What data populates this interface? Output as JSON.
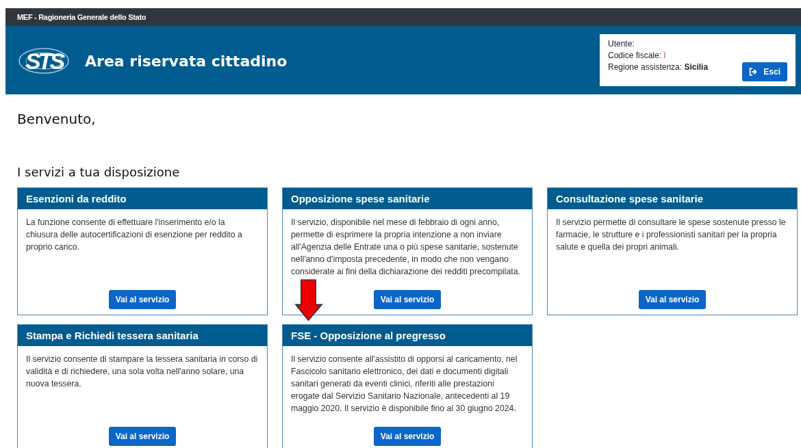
{
  "top_bar": {
    "title": "MEF - Ragioneria Generale dello Stato"
  },
  "header": {
    "logo_text": "STS",
    "title": "Area riservata cittadino"
  },
  "user_panel": {
    "user_label": "Utente:",
    "fiscal_code_label": "Codice fiscale:",
    "fiscal_code_value": "l",
    "region_label": "Regione assistenza:",
    "region_value": "Sicilia",
    "logout_button": "Esci"
  },
  "welcome": "Benvenuto,",
  "services_heading": "I servizi a tua disposizione",
  "services": [
    {
      "title": "Esenzioni da reddito",
      "description": "La funzione consente di effettuare l'inserimento e/o la chiusura delle autocertificazioni di esenzione per reddito a proprio carico.",
      "button": "Vai al servizio"
    },
    {
      "title": "Opposizione spese sanitarie",
      "description": "Il servizio, disponibile nel mese di febbraio di ogni anno, permette di esprimere la propria intenzione a non inviare all'Agenzia delle Entrate una o più spese sanitarie, sostenute nell'anno d'imposta precedente, in modo che non vengano considerate ai fini della dichiarazione dei redditi precompilata.",
      "button": "Vai al servizio"
    },
    {
      "title": "Consultazione spese sanitarie",
      "description": "Il servizio permette di consultare le spese sostenute presso le farmacie, le strutture e i professionisti sanitari per la propria salute e quella dei propri animali.",
      "button": "Vai al servizio"
    },
    {
      "title": "Stampa e Richiedi tessera sanitaria",
      "description": "Il servizio consente di stampare la tessera sanitaria in corso di validità e di richiedere, una sola volta nell'anno solare, una nuova tessera.",
      "button": "Vai al servizio"
    },
    {
      "title": "FSE - Opposizione al pregresso",
      "description": "Il servizio consente all'assistito di opporsi al caricamento, nel Fascicolo sanitario elettronico, dei dati e documenti digitali sanitari generati da eventi clinici, riferiti alle prestazioni erogate dal Servizio Sanitario Nazionale, antecedenti al 19 maggio 2020. Il servizio è disponibile fino al 30 giugno 2024.",
      "button": "Vai al servizio"
    }
  ]
}
